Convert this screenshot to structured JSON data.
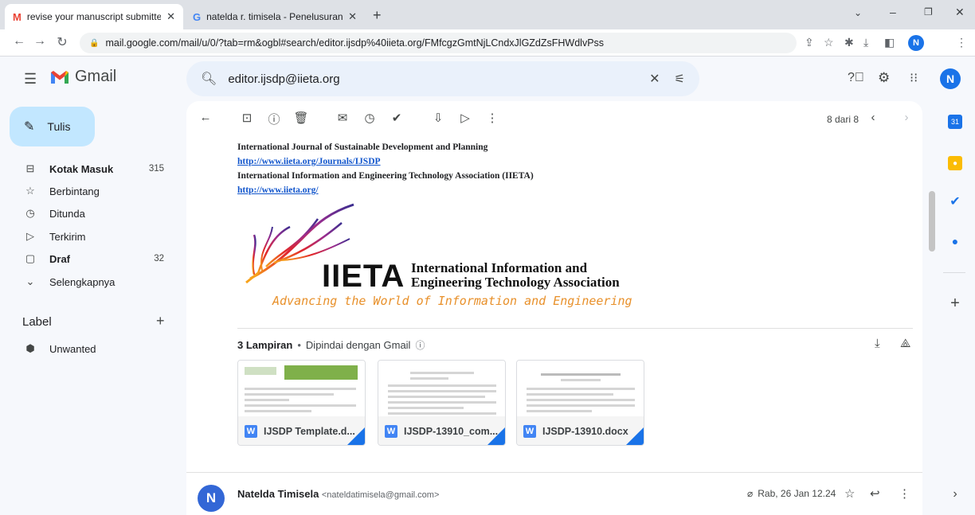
{
  "browser": {
    "tabs": [
      {
        "title": "revise your manuscript submitte",
        "favicon": "gmail-icon"
      },
      {
        "title": "natelda r. timisela - Penelusuran",
        "favicon": "google-icon"
      }
    ],
    "url": "mail.google.com/mail/u/0/?tab=rm&ogbl#search/editor.ijsdp%40iieta.org/FMfcgzGmtNjLCndxJlGZdZsFHWdlvPss",
    "profile_initial": "N"
  },
  "gmail": {
    "logo_text": "Gmail",
    "search_value": "editor.ijsdp@iieta.org",
    "compose_label": "Tulis",
    "nav": [
      {
        "label": "Kotak Masuk",
        "count": "315",
        "bold": true
      },
      {
        "label": "Berbintang",
        "count": ""
      },
      {
        "label": "Ditunda",
        "count": ""
      },
      {
        "label": "Terkirim",
        "count": ""
      },
      {
        "label": "Draf",
        "count": "32",
        "bold": true
      },
      {
        "label": "Selengkapnya",
        "count": ""
      }
    ],
    "labels_heading": "Label",
    "labels": [
      {
        "label": "Unwanted"
      }
    ],
    "pagination": "8 dari 8",
    "profile_initial": "N"
  },
  "message": {
    "signature": {
      "journal": "International Journal of Sustainable Development and Planning",
      "journal_link": "http://www.iieta.org/Journals/IJSDP",
      "association": "International Information and Engineering Technology Association (IIETA)",
      "association_link": "http://www.iieta.org/"
    },
    "logo": {
      "acronym": "IIETA",
      "name_line1": "International Information and",
      "name_line2": "Engineering Technology Association",
      "tagline": "Advancing the World of Information and Engineering"
    },
    "attachments_heading": "3 Lampiran",
    "attachments_scan": "Dipindai dengan Gmail",
    "attachments": [
      {
        "name": "IJSDP Template.d..."
      },
      {
        "name": "IJSDP-13910_com..."
      },
      {
        "name": "IJSDP-13910.docx"
      }
    ],
    "next": {
      "sender": "Natelda Timisela",
      "email": "<nateldatimisela@gmail.com>",
      "date": "Rab, 26 Jan 12.24",
      "avatar_initial": "N"
    }
  },
  "colors": {
    "accent": "#1a73e8",
    "compose": "#c2e7ff",
    "search_bg": "#eaf1fb",
    "link": "#1155cc"
  }
}
